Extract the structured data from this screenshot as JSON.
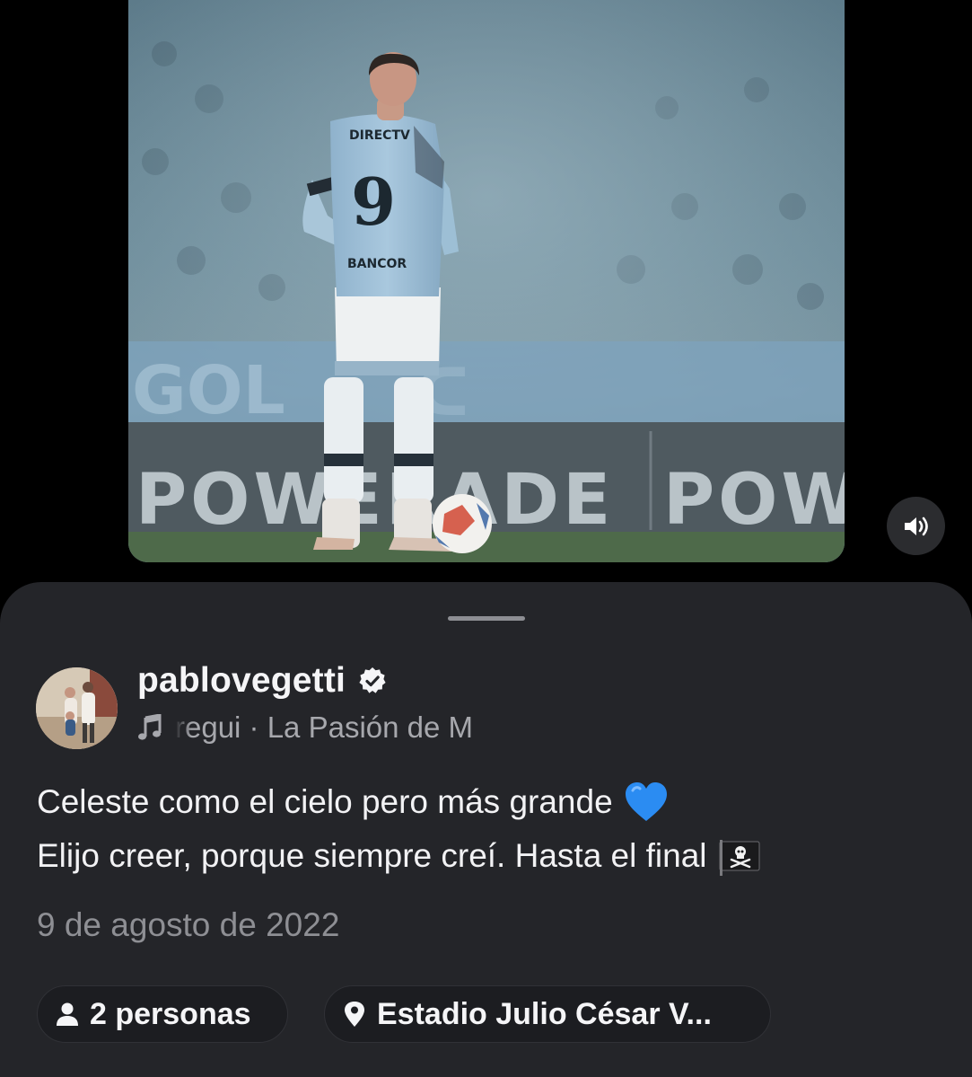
{
  "post": {
    "username": "pablovegetti",
    "music": "regui · La Pasión de M",
    "caption_line1": "Celeste como el cielo pero más grande",
    "caption_line2": "Elijo creer, porque siempre creí. Hasta el final",
    "date": "9 de agosto de 2022",
    "tagged_people": "2 personas",
    "location": "Estadio Julio César V..."
  },
  "photo": {
    "shirt_sponsor": "DIRECTV",
    "shirt_number": "9",
    "shirt_back_sponsor": "BANCOR",
    "banner_text": "POWERADE POW",
    "banner_text_left": "POWERADE",
    "banner_text_right": "POW"
  },
  "icons": {
    "volume": "speaker-wave-icon",
    "verified": "verified-badge-icon",
    "music": "music-note-icon",
    "people": "person-icon",
    "location": "location-pin-icon",
    "heart_emoji": "blue-heart-emoji",
    "flag_emoji": "pirate-flag-emoji"
  },
  "colors": {
    "background": "#000000",
    "sheet": "#242529",
    "chip": "#1c1d21",
    "primary_text": "#f5f5f7",
    "secondary_text": "#8e8f94",
    "heart": "#2b8cf2"
  }
}
